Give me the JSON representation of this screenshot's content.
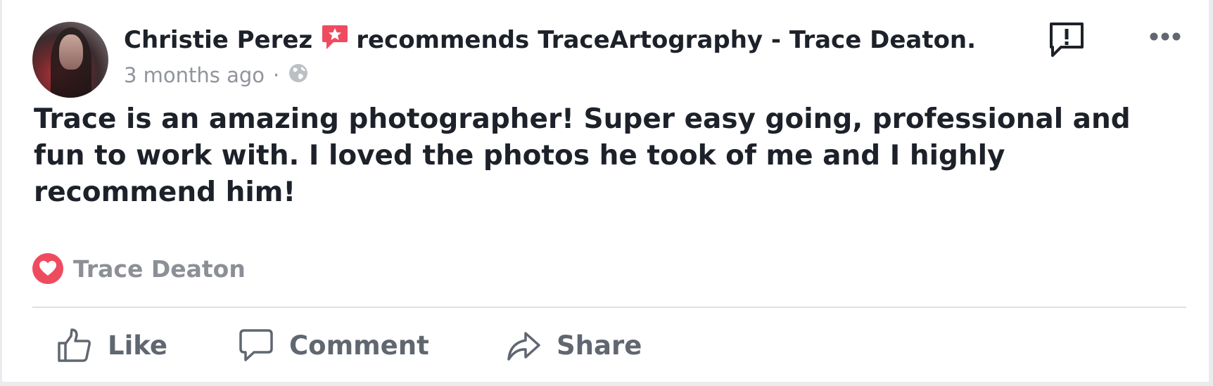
{
  "post": {
    "author": "Christie Perez",
    "recommends_text": "recommends",
    "page_name": "TraceArtography - Trace Deaton.",
    "timestamp": "3 months ago",
    "separator": "·",
    "privacy_icon": "globe-icon",
    "review": "Trace is an amazing photographer! Super easy going, professional and fun to work with. I loved the photos he took of me and I highly recommend him!",
    "reaction_icon": "heart-icon",
    "reaction_name": "Trace Deaton"
  },
  "actions": {
    "like": "Like",
    "comment": "Comment",
    "share": "Share"
  },
  "icons": {
    "recommend_badge": "recommend-badge-icon",
    "report": "report-icon",
    "more": "more-icon"
  },
  "colors": {
    "heart": "#ef4b5f",
    "recommend_badge": "#ef4b5f",
    "text": "#1d2129",
    "muted": "#90949c",
    "action": "#606770"
  }
}
